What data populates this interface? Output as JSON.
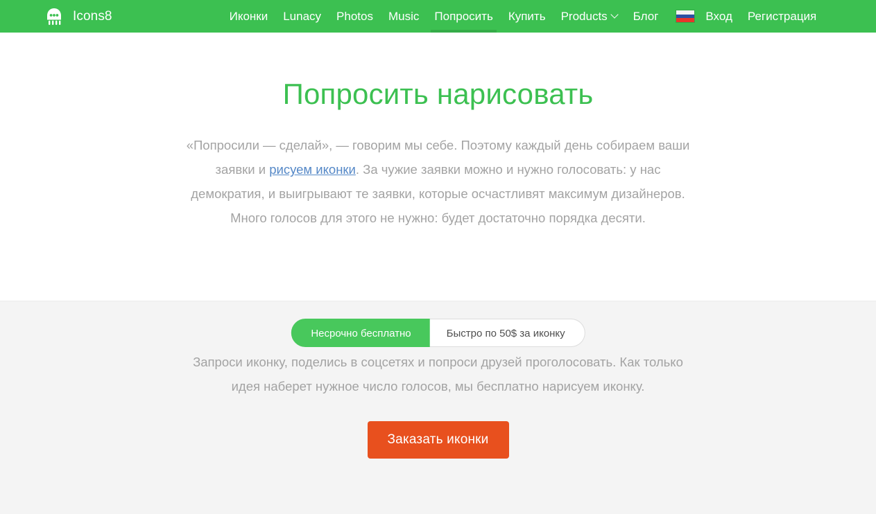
{
  "header": {
    "brand": {
      "name": "Icons8",
      "logo_icon": "icons8-robot-logo-icon"
    },
    "background_color": "#3cc051",
    "nav": [
      {
        "label": "Иконки",
        "active": false
      },
      {
        "label": "Lunacy",
        "active": false
      },
      {
        "label": "Photos",
        "active": false
      },
      {
        "label": "Music",
        "active": false
      },
      {
        "label": "Попросить",
        "active": true
      },
      {
        "label": "Купить",
        "active": false
      },
      {
        "label": "Products",
        "active": false,
        "has_dropdown": true
      },
      {
        "label": "Блог",
        "active": false
      }
    ],
    "language_flag": "russian-flag-icon",
    "auth": {
      "login_label": "Вход",
      "register_label": "Регистрация"
    }
  },
  "main": {
    "title": "Попросить нарисовать",
    "title_color": "#3cc051",
    "intro": {
      "part1": "«Попросили — сделай», — говорим мы себе. Поэтому каждый день собираем ваши заявки и ",
      "link": "рисуем иконки",
      "link_color": "#5588c7",
      "part2": ". За чужие заявки можно и нужно голосовать: у нас демократия, и выигрывают те заявки, которые осчастливят максимум дизайнеров. Много голосов для этого не нужно: будет достаточно порядка десяти."
    },
    "toggle": {
      "options": [
        {
          "label": "Несрочно бесплатно",
          "selected": true
        },
        {
          "label": "Быстро по 50$ за иконку",
          "selected": false
        }
      ],
      "active_color": "#48c85c"
    },
    "description": "Запроси иконку, поделись в соцсетях и попроси друзей проголосовать. Как только идея наберет нужное число голосов, мы бесплатно нарисуем иконку.",
    "cta": {
      "label": "Заказать иконки",
      "color": "#e8501e"
    }
  }
}
